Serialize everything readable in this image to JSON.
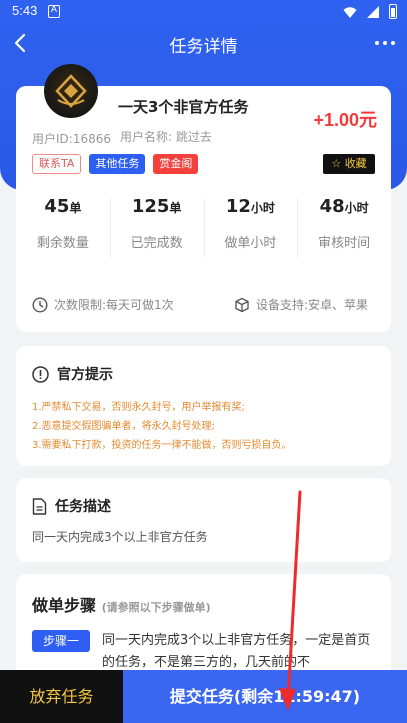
{
  "status_bar": {
    "time": "5:43",
    "alert_glyph": "A"
  },
  "nav": {
    "title": "任务详情"
  },
  "task": {
    "title": "一天3个非官方任务",
    "reward": "+1.00元",
    "user_id": "用户ID:16866",
    "user_name": "用户名称:  跳过去",
    "tags": [
      "联系TA",
      "其他任务",
      "赏金阁"
    ],
    "favorite": "收藏"
  },
  "stats": [
    {
      "value": "45",
      "unit": "单",
      "label": "剩余数量"
    },
    {
      "value": "125",
      "unit": "单",
      "label": "已完成数"
    },
    {
      "value": "12",
      "unit": "小时",
      "label": "做单小时"
    },
    {
      "value": "48",
      "unit": "小时",
      "label": "审核时间"
    }
  ],
  "limits": {
    "times": "次数限制:每天可做1次",
    "devices": "设备支持:安卓、苹果"
  },
  "official_tip": {
    "title": "官方提示",
    "lines": [
      "1.严禁私下交易，否则永久封号，用户举报有奖;",
      "2.恶意提交假图骗单者，将永久封号处理;",
      "3.需要私下打款，投资的任务一律不能做，否则亏损自负。"
    ]
  },
  "description": {
    "title": "任务描述",
    "text": "同一天内完成3个以上非官方任务"
  },
  "steps": {
    "title": "做单步骤",
    "subtitle": "(请参照以下步骤做单)",
    "step1_badge": "步骤一",
    "step1_text": "同一天内完成3个以上非官方任务，一定是首页的任务，不是第三方的，几天前的不"
  },
  "bottom": {
    "give_up": "放弃任务",
    "submit": "提交任务(剩余11:59:47)"
  },
  "colors": {
    "primary_blue": "#2e5ff2",
    "reward_red": "#f23a3a",
    "tip_orange": "#e6892e",
    "gold": "#f4c842"
  },
  "icons": [
    "back-arrow-icon",
    "more-icon",
    "clock-icon",
    "cube-icon",
    "info-circle-icon",
    "document-icon",
    "star-icon"
  ]
}
